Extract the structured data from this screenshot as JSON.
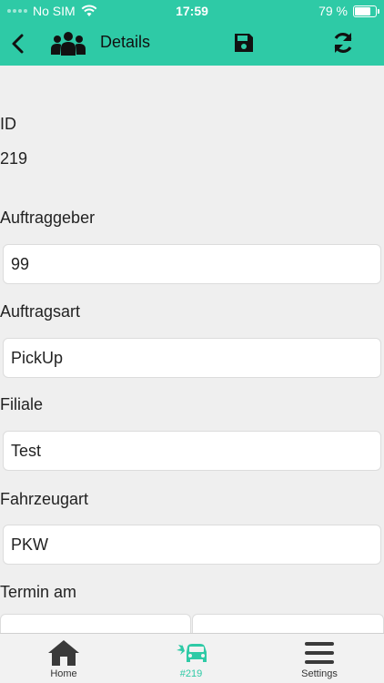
{
  "status_bar": {
    "carrier": "No SIM",
    "time": "17:59",
    "battery_percent": "79 %",
    "battery_level": 0.79
  },
  "nav": {
    "title": "Details"
  },
  "form": {
    "id_label": "ID",
    "id_value": "219",
    "auftraggeber_label": "Auftraggeber",
    "auftraggeber_value": "99",
    "auftragsart_label": "Auftragsart",
    "auftragsart_value": "PickUp",
    "filiale_label": "Filiale",
    "filiale_value": "Test",
    "fahrzeugart_label": "Fahrzeugart",
    "fahrzeugart_value": "PKW",
    "termin_label": "Termin am"
  },
  "tabs": [
    {
      "label": "Home"
    },
    {
      "label": "#219"
    },
    {
      "label": "Settings"
    }
  ],
  "colors": {
    "accent": "#2ecaa6",
    "background": "#efefef"
  }
}
